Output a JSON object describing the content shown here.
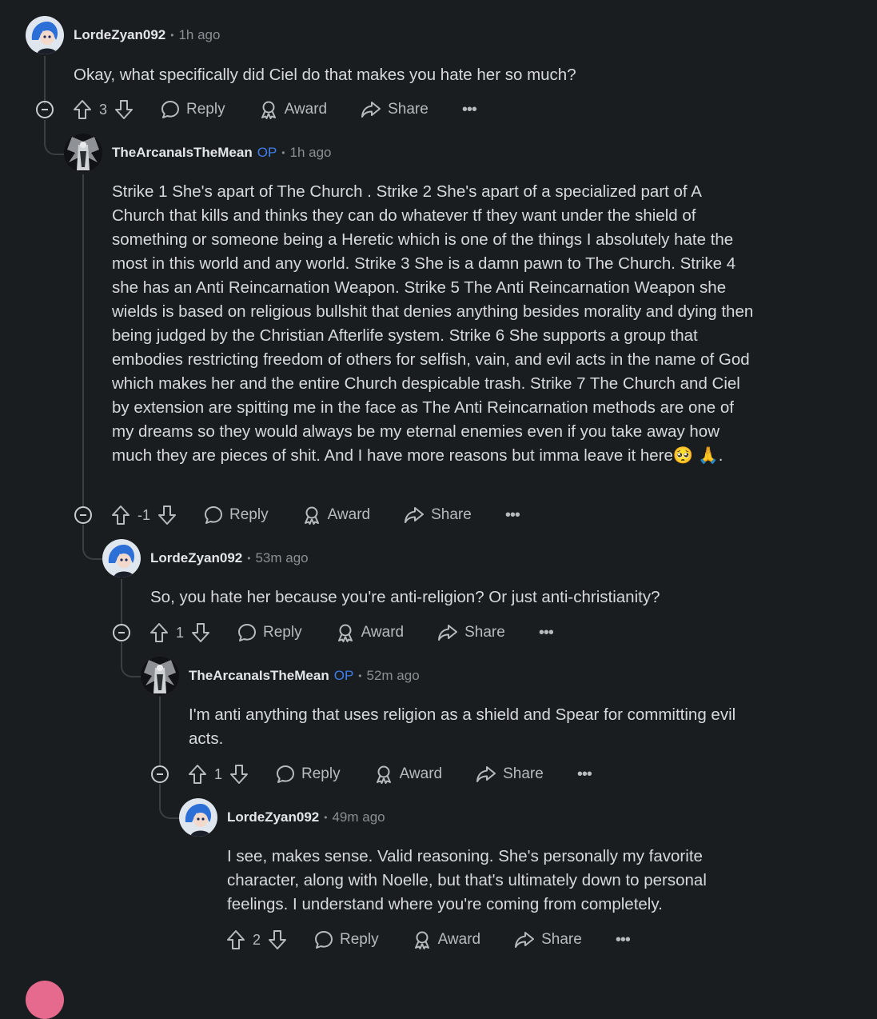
{
  "comments": [
    {
      "username": "LordeZyan092",
      "op_label": "",
      "time": "1h ago",
      "body": "Okay, what specifically did Ciel do that makes you hate her so much?",
      "score": "3"
    },
    {
      "username": "TheArcanaIsTheMean",
      "op_label": "OP",
      "time": "1h ago",
      "body": "Strike 1 She's apart of The Church . Strike 2 She's apart of a specialized part of A Church that kills and thinks they can do whatever tf they want under the shield of something or someone being a Heretic which is one of the things I absolutely hate the most in this world and any world. Strike 3 She is a damn pawn to The Church. Strike 4 she has an Anti Reincarnation Weapon. Strike 5 The Anti Reincarnation Weapon she wields is based on religious bullshit that denies anything besides morality and dying then being judged by the Christian Afterlife system. Strike 6 She supports a group that embodies restricting freedom of others for selfish, vain, and evil acts in the name of God which makes her and the entire Church despicable trash. Strike 7 The Church and Ciel by extension are spitting me in the face as The Anti Reincarnation methods are one of my dreams so they would always be my eternal enemies even if you take away how much they are pieces of shit. And I have more reasons but imma leave it here",
      "emoji_1": "🥺",
      "emoji_2": "🙏",
      "body_end": ".",
      "score": "-1"
    },
    {
      "username": "LordeZyan092",
      "op_label": "",
      "time": "53m ago",
      "body": "So, you hate her because you're anti-religion? Or just anti-christianity?",
      "score": "1"
    },
    {
      "username": "TheArcanaIsTheMean",
      "op_label": "OP",
      "time": "52m ago",
      "body": "I'm anti anything that uses religion as a shield and Spear for committing evil acts.",
      "score": "1"
    },
    {
      "username": "LordeZyan092",
      "op_label": "",
      "time": "49m ago",
      "body": "I see, makes sense. Valid reasoning. She's personally my favorite character, along with Noelle, but that's ultimately down to personal feelings. I understand where you're coming from completely.",
      "score": "2"
    }
  ],
  "actions": {
    "reply": "Reply",
    "award": "Award",
    "share": "Share",
    "more": "•••",
    "separator": "•"
  },
  "icons": [
    "collapse-icon",
    "upvote-icon",
    "downvote-icon",
    "reply-icon",
    "award-icon",
    "share-icon",
    "more-icon"
  ],
  "colors": {
    "background": "#1a1d20",
    "op": "#3f7ee8",
    "thread_line": "#3a3f44"
  }
}
